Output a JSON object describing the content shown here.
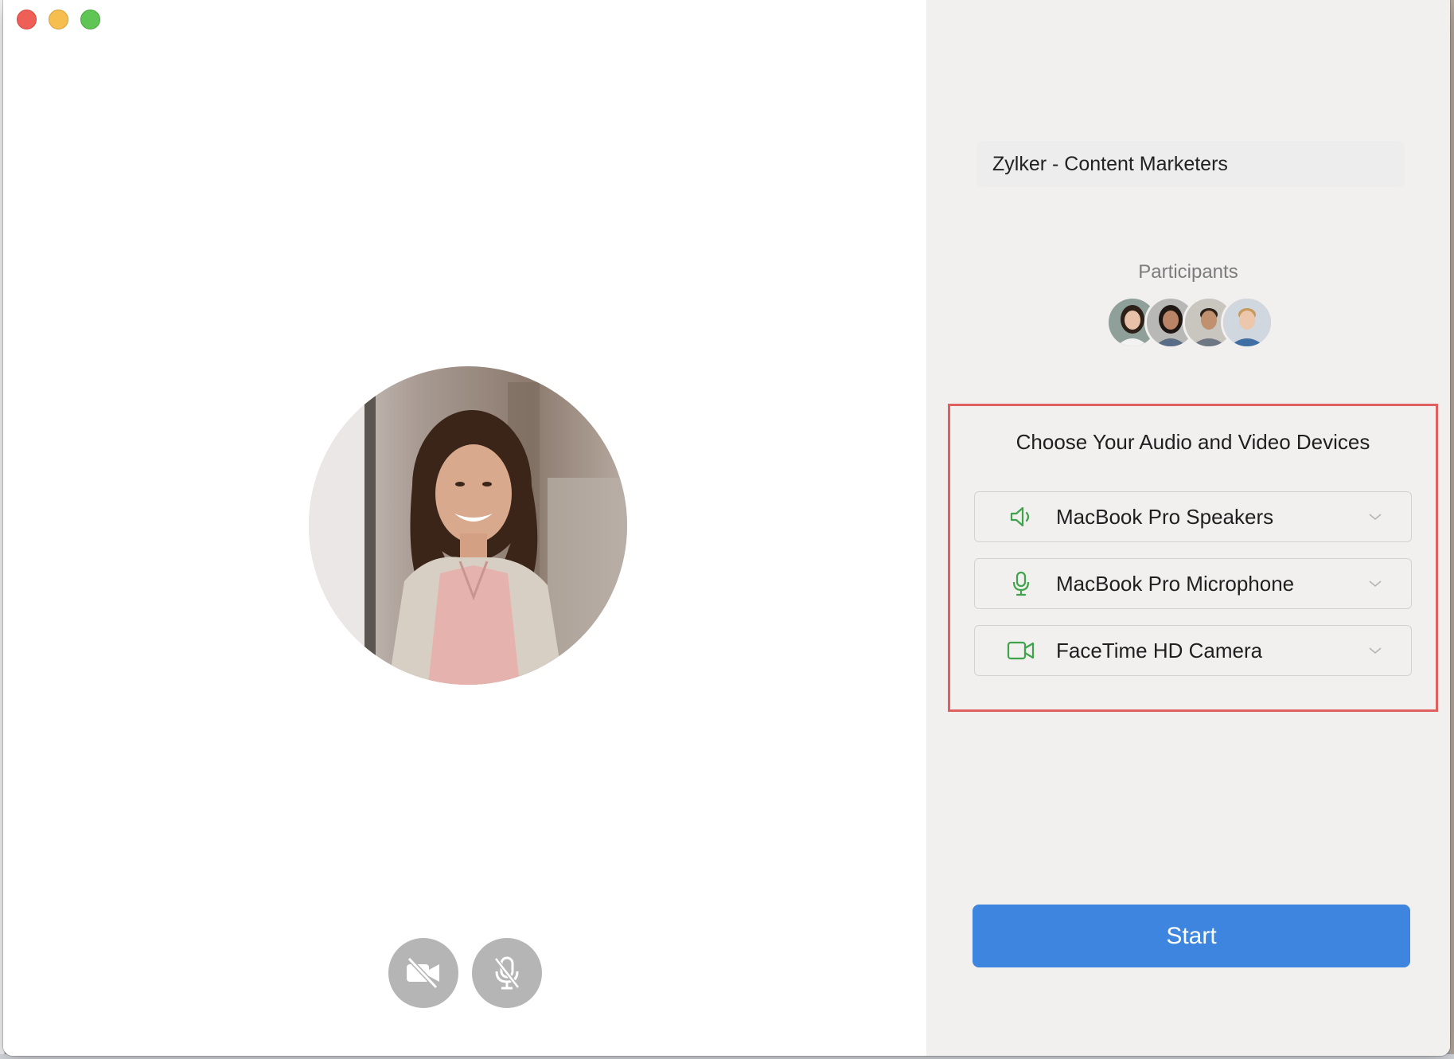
{
  "window": {
    "traffic_lights": [
      "close",
      "minimize",
      "maximize"
    ]
  },
  "self_view": {
    "video_off_button_icon": "video-off-icon",
    "mic_off_button_icon": "mic-off-icon"
  },
  "meeting": {
    "title": "Zylker - Content Marketers"
  },
  "participants": {
    "label": "Participants",
    "count": 4
  },
  "devices": {
    "heading": "Choose Your Audio and Video Devices",
    "speaker": {
      "label": "MacBook Pro Speakers",
      "icon": "speaker-icon"
    },
    "microphone": {
      "label": "MacBook Pro Microphone",
      "icon": "microphone-icon"
    },
    "camera": {
      "label": "FaceTime HD Camera",
      "icon": "camera-icon"
    }
  },
  "actions": {
    "start_label": "Start"
  },
  "colors": {
    "accent_blue": "#3d85de",
    "device_icon_green": "#3ea34a",
    "highlight_red": "#e06060",
    "right_pane_bg": "#f2f0ef"
  }
}
